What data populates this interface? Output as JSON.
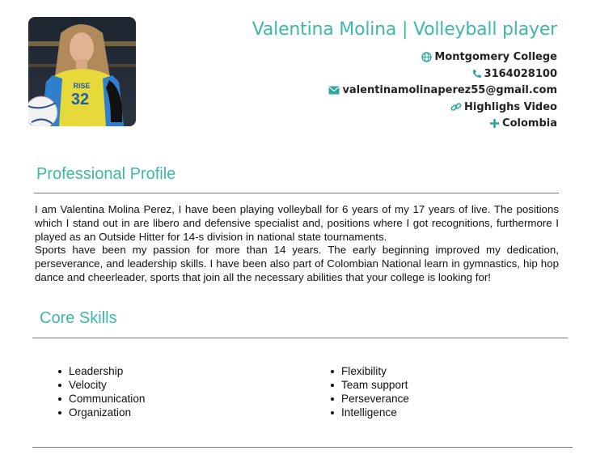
{
  "header": {
    "name": "Valentina Molina | Volleyball player",
    "contacts": [
      {
        "icon": "globe-icon",
        "text": "Montgomery College"
      },
      {
        "icon": "phone-icon",
        "text": "3164028100"
      },
      {
        "icon": "envelope-icon",
        "text": "valentinamolinaperez55@gmail.com"
      },
      {
        "icon": "link-icon",
        "text": "Highlighs Video"
      },
      {
        "icon": "plus-icon",
        "text": "Colombia"
      }
    ],
    "photo": {
      "jersey_text": "RISE",
      "jersey_number": "32"
    }
  },
  "profile": {
    "title": "Professional Profile",
    "paragraphs": [
      "I am Valentina Molina Perez, I have been playing volleyball for 6 years of my 17 years of live. The positions which I stand out in are libero and defensive specialist and, positions where I got recognitions, furthermore I played as an Outside Hitter for 14-s division in national state tournaments.",
      "Sports have been my passion for more than 14 years. The early beginning improved my dedication, perseverance, and leadership skills. I have been also part of Colombian National learn in gymnastics, hip hop dance and cheerleader, sports that join all the necessary abilities that your college is looking for!"
    ]
  },
  "skills": {
    "title": "Core Skills",
    "left": [
      "Leadership",
      "Velocity",
      "Communication",
      "Organization"
    ],
    "right": [
      "Flexibility",
      "Team support",
      "Perseverance",
      "Intelligence"
    ]
  },
  "colors": {
    "accent": "#3db8a8",
    "icon": "#2fa89a",
    "rule": "#777777"
  }
}
